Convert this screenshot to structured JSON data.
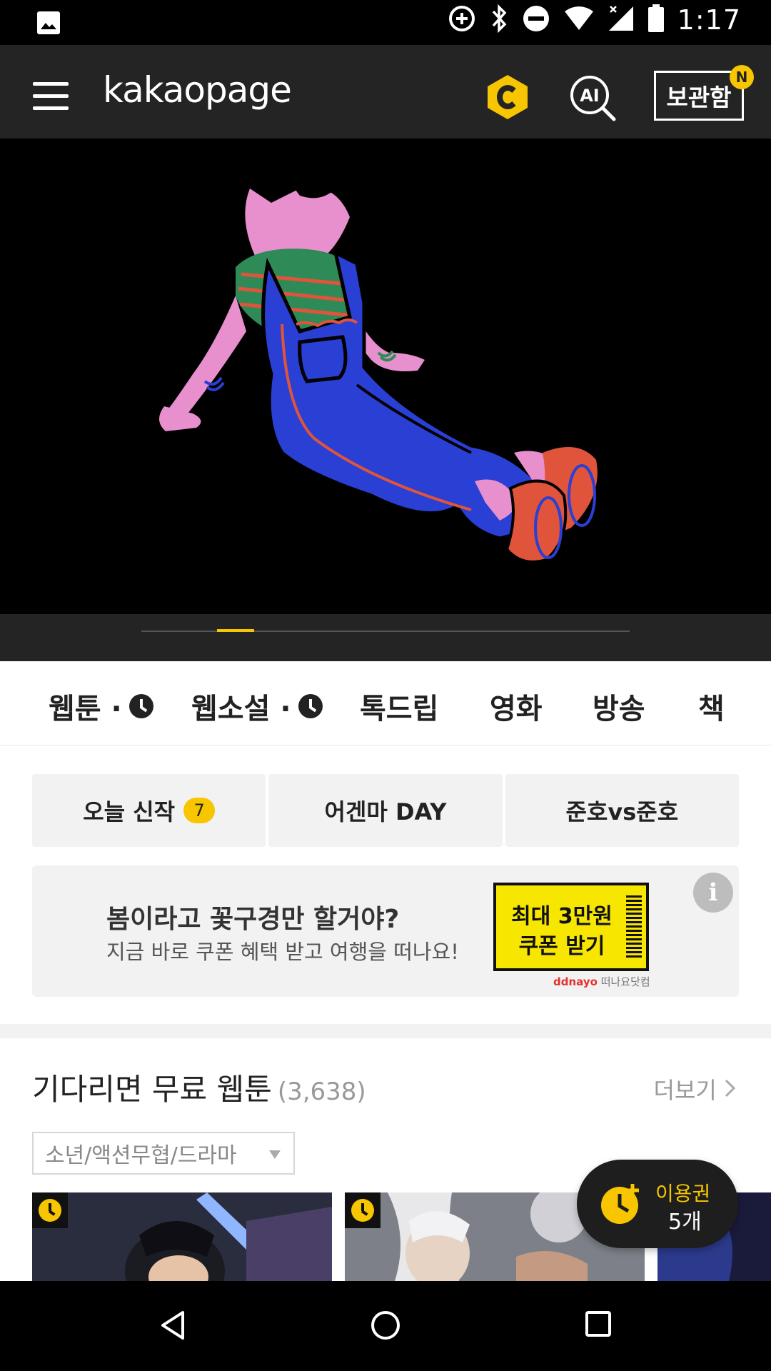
{
  "status_bar": {
    "time": "1:17"
  },
  "app_bar": {
    "logo": "kakaopage",
    "library_label": "보관함",
    "new_badge": "N",
    "coin_icon": "kakao-cash-icon",
    "ai_search_icon": "ai-search-icon",
    "ai_label": "AI"
  },
  "colors": {
    "accent": "#f7c600",
    "bar": "#242424"
  },
  "categories": [
    {
      "label": "웹툰 ·",
      "clock": true
    },
    {
      "label": "웹소설 ·",
      "clock": true
    },
    {
      "label": "톡드립",
      "clock": false
    },
    {
      "label": "영화",
      "clock": false
    },
    {
      "label": "방송",
      "clock": false
    },
    {
      "label": "책",
      "clock": false
    }
  ],
  "quick_buttons": [
    {
      "label": "오늘 신작",
      "badge": "7"
    },
    {
      "label": "어겐마 DAY"
    },
    {
      "label": "준호vs준호"
    }
  ],
  "ad": {
    "title": "봄이라고 꽃구경만 할거야?",
    "subtitle": "지금 바로 쿠폰 혜택 받고 여행을 떠나요!",
    "ticket_line1": "최대 3만원",
    "ticket_line2": "쿠폰 받기",
    "brand_en": "ddnayo",
    "brand_kr": "떠나요닷컴",
    "info": "i"
  },
  "section": {
    "title": "기다리면 무료 웹툰",
    "count": "(3,638)",
    "more": "더보기",
    "genre": "소년/액션무협/드라마"
  },
  "fab": {
    "line1": "이용권",
    "line2": "5개"
  }
}
